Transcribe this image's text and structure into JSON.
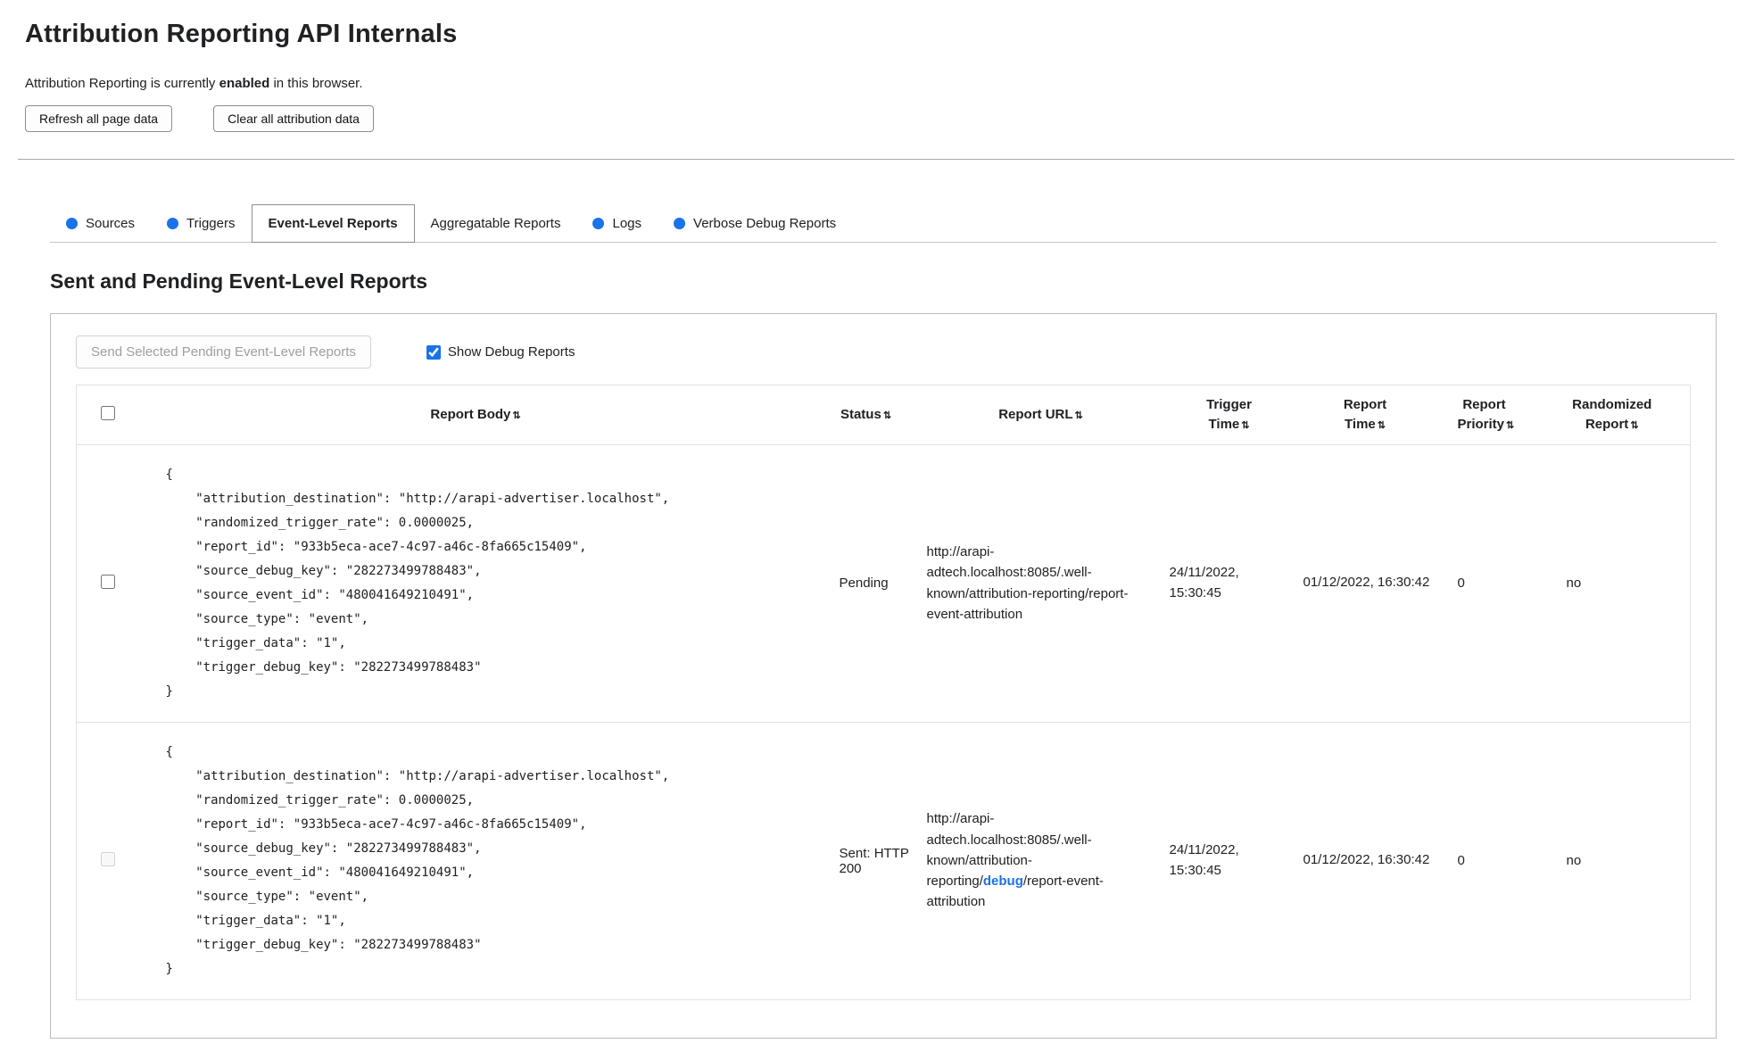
{
  "header": {
    "title": "Attribution Reporting API Internals",
    "status": {
      "prefix": "Attribution Reporting is currently ",
      "emphasis": "enabled",
      "suffix": " in this browser."
    },
    "buttons": {
      "refresh": "Refresh all page data",
      "clear": "Clear all attribution data"
    }
  },
  "tabs": [
    {
      "label": "Sources",
      "has_dot": true,
      "active": false
    },
    {
      "label": "Triggers",
      "has_dot": true,
      "active": false
    },
    {
      "label": "Event-Level Reports",
      "has_dot": false,
      "active": true
    },
    {
      "label": "Aggregatable Reports",
      "has_dot": false,
      "active": false
    },
    {
      "label": "Logs",
      "has_dot": true,
      "active": false
    },
    {
      "label": "Verbose Debug Reports",
      "has_dot": true,
      "active": false
    }
  ],
  "report_section": {
    "heading": "Sent and Pending Event-Level Reports",
    "send_button_label": "Send Selected Pending Event-Level Reports",
    "send_button_enabled": false,
    "show_debug_label": "Show Debug Reports",
    "show_debug_checked": true
  },
  "table": {
    "headers": [
      "Report Body",
      "Status",
      "Report URL",
      "Trigger Time",
      "Report Time",
      "Report Priority",
      "Randomized Report"
    ],
    "rows": [
      {
        "selected": false,
        "checkbox_disabled": false,
        "report_body": "{\n    \"attribution_destination\": \"http://arapi-advertiser.localhost\",\n    \"randomized_trigger_rate\": 0.0000025,\n    \"report_id\": \"933b5eca-ace7-4c97-a46c-8fa665c15409\",\n    \"source_debug_key\": \"282273499788483\",\n    \"source_event_id\": \"480041649210491\",\n    \"source_type\": \"event\",\n    \"trigger_data\": \"1\",\n    \"trigger_debug_key\": \"282273499788483\"\n}",
        "status": "Pending",
        "url": {
          "prefix": "http://arapi-adtech.localhost:8085/.well-known/attribution-reporting/",
          "link": "",
          "suffix": "report-event-attribution"
        },
        "trigger_time": "24/11/2022, 15:30:45",
        "report_time": "01/12/2022, 16:30:42",
        "priority": "0",
        "randomized": "no"
      },
      {
        "selected": false,
        "checkbox_disabled": true,
        "report_body": "{\n    \"attribution_destination\": \"http://arapi-advertiser.localhost\",\n    \"randomized_trigger_rate\": 0.0000025,\n    \"report_id\": \"933b5eca-ace7-4c97-a46c-8fa665c15409\",\n    \"source_debug_key\": \"282273499788483\",\n    \"source_event_id\": \"480041649210491\",\n    \"source_type\": \"event\",\n    \"trigger_data\": \"1\",\n    \"trigger_debug_key\": \"282273499788483\"\n}",
        "status": "Sent: HTTP 200",
        "url": {
          "prefix": "http://arapi-adtech.localhost:8085/.well-known/attribution-reporting/",
          "link": "debug",
          "suffix": "/report-event-attribution"
        },
        "trigger_time": "24/11/2022, 15:30:45",
        "report_time": "01/12/2022, 16:30:42",
        "priority": "0",
        "randomized": "no"
      }
    ]
  },
  "icons": {
    "sort": "⇅"
  },
  "colors": {
    "accent_blue": "#1a73e8"
  }
}
